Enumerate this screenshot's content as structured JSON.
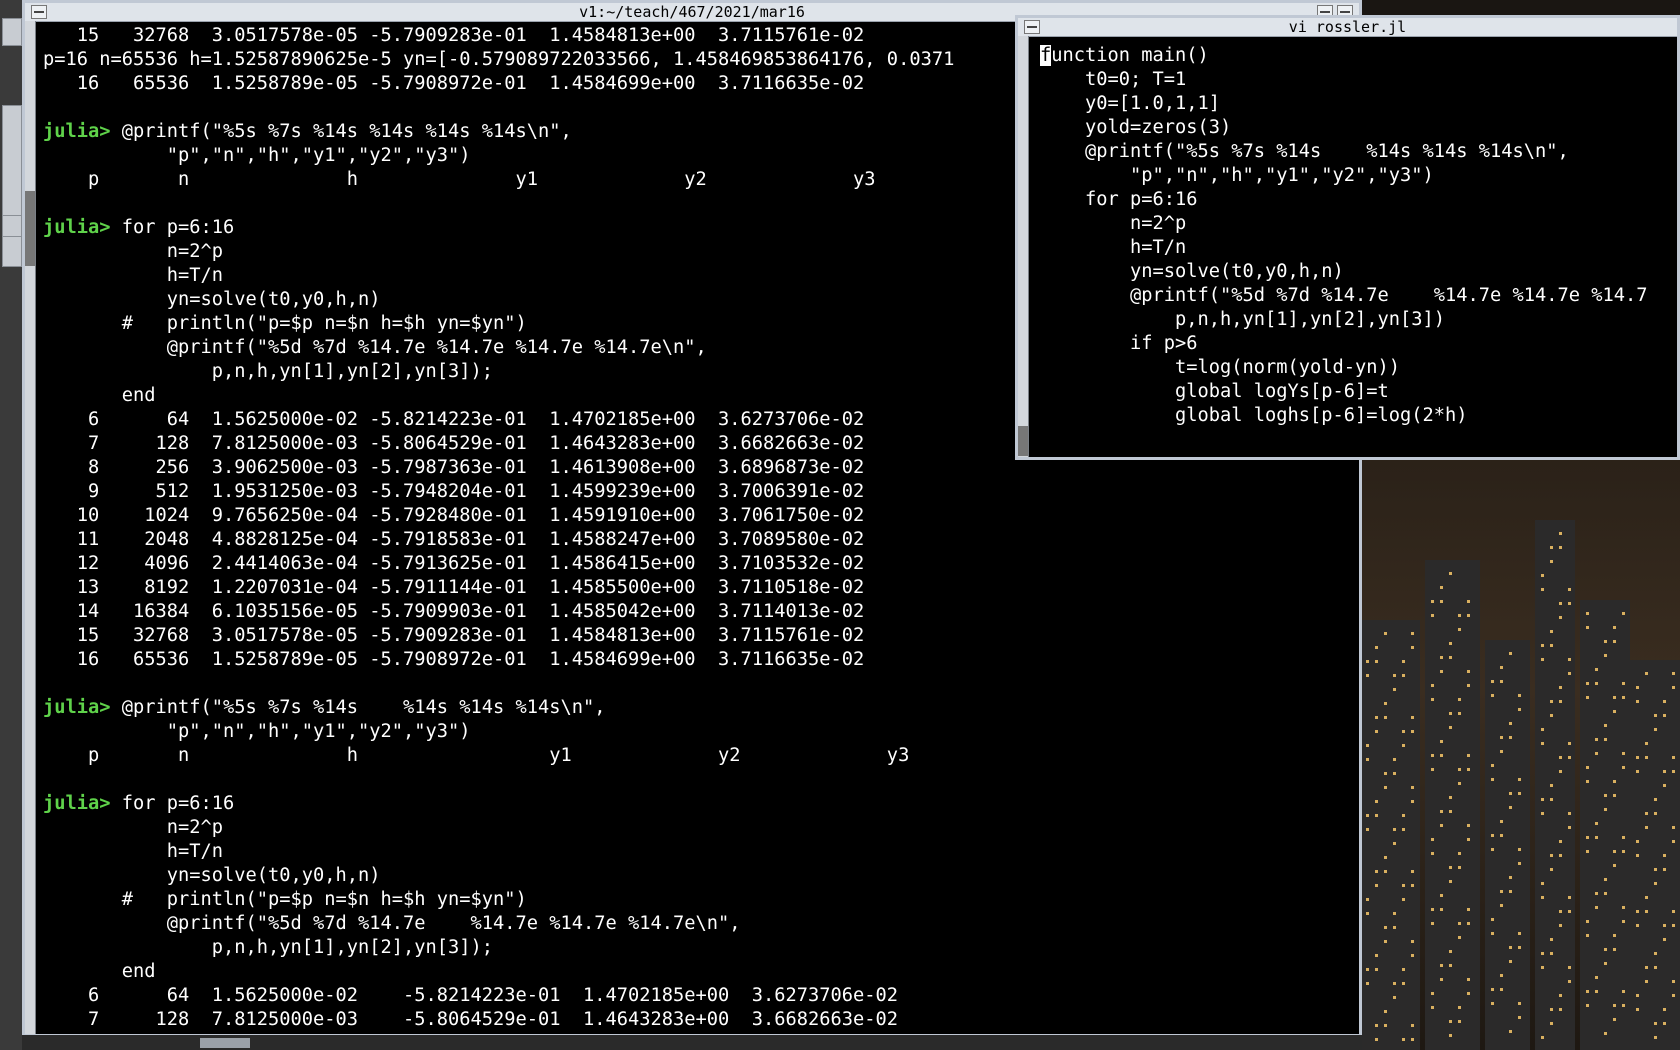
{
  "terminal": {
    "title": "v1:~/teach/467/2021/mar16",
    "lines": [
      "   15   32768  3.0517578e-05 -5.7909283e-01  1.4584813e+00  3.7115761e-02",
      "p=16 n=65536 h=1.52587890625e-5 yn=[-0.579089722033566, 1.458469853864176, 0.0371",
      "   16   65536  1.5258789e-05 -5.7908972e-01  1.4584699e+00  3.7116635e-02",
      "",
      "julia> @printf(\"%5s %7s %14s %14s %14s %14s\\n\",",
      "           \"p\",\"n\",\"h\",\"y1\",\"y2\",\"y3\")",
      "    p       n              h              y1             y2             y3",
      "",
      "julia> for p=6:16",
      "           n=2^p",
      "           h=T/n",
      "           yn=solve(t0,y0,h,n)",
      "       #   println(\"p=$p n=$n h=$h yn=$yn\")",
      "           @printf(\"%5d %7d %14.7e %14.7e %14.7e %14.7e\\n\",",
      "               p,n,h,yn[1],yn[2],yn[3]);",
      "       end",
      "    6      64  1.5625000e-02 -5.8214223e-01  1.4702185e+00  3.6273706e-02",
      "    7     128  7.8125000e-03 -5.8064529e-01  1.4643283e+00  3.6682663e-02",
      "    8     256  3.9062500e-03 -5.7987363e-01  1.4613908e+00  3.6896873e-02",
      "    9     512  1.9531250e-03 -5.7948204e-01  1.4599239e+00  3.7006391e-02",
      "   10    1024  9.7656250e-04 -5.7928480e-01  1.4591910e+00  3.7061750e-02",
      "   11    2048  4.8828125e-04 -5.7918583e-01  1.4588247e+00  3.7089580e-02",
      "   12    4096  2.4414063e-04 -5.7913625e-01  1.4586415e+00  3.7103532e-02",
      "   13    8192  1.2207031e-04 -5.7911144e-01  1.4585500e+00  3.7110518e-02",
      "   14   16384  6.1035156e-05 -5.7909903e-01  1.4585042e+00  3.7114013e-02",
      "   15   32768  3.0517578e-05 -5.7909283e-01  1.4584813e+00  3.7115761e-02",
      "   16   65536  1.5258789e-05 -5.7908972e-01  1.4584699e+00  3.7116635e-02",
      "",
      "julia> @printf(\"%5s %7s %14s    %14s %14s %14s\\n\",",
      "           \"p\",\"n\",\"h\",\"y1\",\"y2\",\"y3\")",
      "    p       n              h                 y1             y2             y3",
      "",
      "julia> for p=6:16",
      "           n=2^p",
      "           h=T/n",
      "           yn=solve(t0,y0,h,n)",
      "       #   println(\"p=$p n=$n h=$h yn=$yn\")",
      "           @printf(\"%5d %7d %14.7e    %14.7e %14.7e %14.7e\\n\",",
      "               p,n,h,yn[1],yn[2],yn[3]);",
      "       end",
      "    6      64  1.5625000e-02    -5.8214223e-01  1.4702185e+00  3.6273706e-02",
      "    7     128  7.8125000e-03    -5.8064529e-01  1.4643283e+00  3.6682663e-02"
    ]
  },
  "editor": {
    "title": "vi rossler.jl",
    "first_char": "f",
    "first_rest": "unction main()",
    "lines": [
      "    t0=0; T=1",
      "    y0=[1.0,1,1]",
      "    yold=zeros(3)",
      "    @printf(\"%5s %7s %14s    %14s %14s %14s\\n\",",
      "        \"p\",\"n\",\"h\",\"y1\",\"y2\",\"y3\")",
      "    for p=6:16",
      "        n=2^p",
      "        h=T/n",
      "        yn=solve(t0,y0,h,n)",
      "        @printf(\"%5d %7d %14.7e    %14.7e %14.7e %14.7",
      "            p,n,h,yn[1],yn[2],yn[3])",
      "        if p>6",
      "            t=log(norm(yold-yn))",
      "            global logYs[p-6]=t",
      "            global loghs[p-6]=log(2*h)"
    ]
  },
  "colors": {
    "prompt": "#5fd24a",
    "terminal_bg": "#000000",
    "titlebar_bg": "#dfe4ea"
  }
}
